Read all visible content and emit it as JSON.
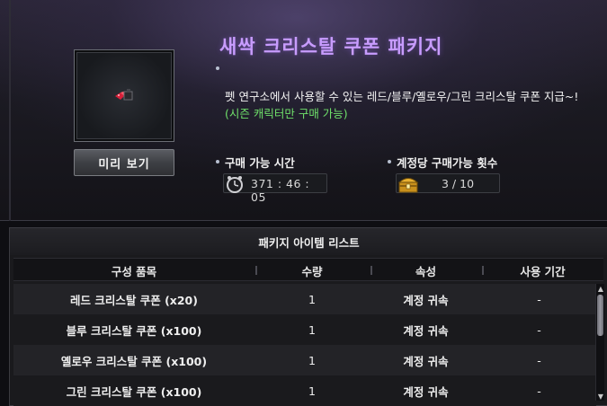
{
  "package": {
    "title": "새싹 크리스탈 쿠폰 패키지",
    "description_main": "펫 연구소에서 사용할 수 있는 레드/블루/옐로우/그린 크리스탈 쿠폰 지급~!",
    "description_note": "(시즌 캐릭터만 구매 가능)",
    "preview_button": "미리 보기",
    "item_icon": "crystal-coupon-icon"
  },
  "purchase_time": {
    "label": "구매 가능 시간",
    "value": "371 : 46 : 05",
    "icon": "alarm-clock-icon"
  },
  "purchase_count": {
    "label": "계정당 구매가능 횟수",
    "value": "3 / 10",
    "icon": "treasure-chest-icon"
  },
  "item_list": {
    "title": "패키지 아이템 리스트",
    "columns": [
      "구성 품목",
      "수량",
      "속성",
      "사용 기간"
    ],
    "rows": [
      {
        "name": "레드 크리스탈 쿠폰 (x20)",
        "qty": "1",
        "attr": "계정 귀속",
        "period": "-"
      },
      {
        "name": "블루 크리스탈 쿠폰 (x100)",
        "qty": "1",
        "attr": "계정 귀속",
        "period": "-"
      },
      {
        "name": "옐로우 크리스탈 쿠폰 (x100)",
        "qty": "1",
        "attr": "계정 귀속",
        "period": "-"
      },
      {
        "name": "그린 크리스탈 쿠폰 (x100)",
        "qty": "1",
        "attr": "계정 귀속",
        "period": "-"
      }
    ]
  },
  "colors": {
    "title": "#c89cff",
    "note_green": "#6fe06a"
  }
}
